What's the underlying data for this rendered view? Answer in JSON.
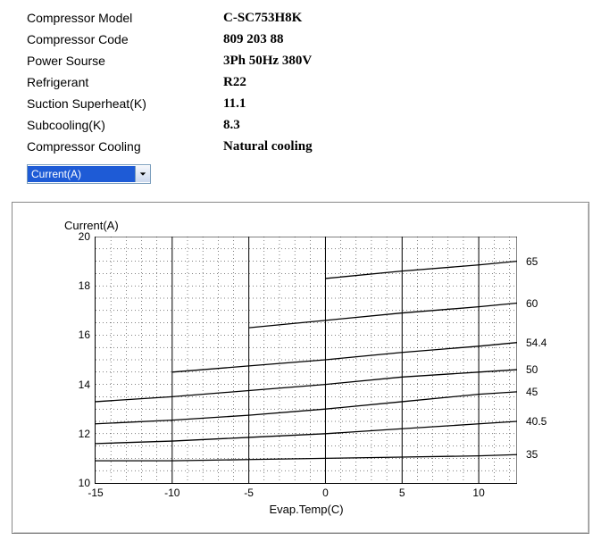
{
  "specs": [
    {
      "label": "Compressor Model",
      "value": "C-SC753H8K"
    },
    {
      "label": "Compressor Code",
      "value": "809 203 88"
    },
    {
      "label": "Power Sourse",
      "value": "3Ph  50Hz  380V"
    },
    {
      "label": "Refrigerant",
      "value": "R22"
    },
    {
      "label": "Suction Superheat(K)",
      "value": "11.1"
    },
    {
      "label": "Subcooling(K)",
      "value": "8.3"
    },
    {
      "label": "Compressor Cooling",
      "value": "Natural cooling"
    }
  ],
  "dropdown": {
    "selected": "Current(A)"
  },
  "chart_data": {
    "type": "line",
    "title": "Current(A)",
    "xlabel": "Evap.Temp(C)",
    "ylabel": "Current(A)",
    "xlim": [
      -15,
      12.5
    ],
    "ylim": [
      10,
      20
    ],
    "xticks": [
      -15,
      -10,
      -5,
      0,
      5,
      10
    ],
    "yticks": [
      10,
      12,
      14,
      16,
      18,
      20
    ],
    "x": [
      -15,
      -10,
      -5,
      0,
      5,
      10,
      12.5
    ],
    "series": [
      {
        "name": "35",
        "values": [
          10.9,
          10.9,
          10.95,
          11.0,
          11.05,
          11.1,
          11.15
        ]
      },
      {
        "name": "40.5",
        "values": [
          11.6,
          11.7,
          11.85,
          12.0,
          12.2,
          12.4,
          12.5
        ]
      },
      {
        "name": "45",
        "values": [
          12.4,
          12.55,
          12.75,
          13.0,
          13.3,
          13.6,
          13.7
        ]
      },
      {
        "name": "50",
        "values": [
          13.3,
          13.5,
          13.75,
          14.0,
          14.3,
          14.5,
          14.6
        ]
      },
      {
        "name": "54.4",
        "values": [
          null,
          14.5,
          14.75,
          15.0,
          15.3,
          15.55,
          15.7
        ]
      },
      {
        "name": "60",
        "values": [
          null,
          null,
          16.3,
          16.6,
          16.9,
          17.15,
          17.3
        ]
      },
      {
        "name": "65",
        "values": [
          null,
          null,
          null,
          18.3,
          18.6,
          18.85,
          19.0
        ]
      }
    ]
  }
}
